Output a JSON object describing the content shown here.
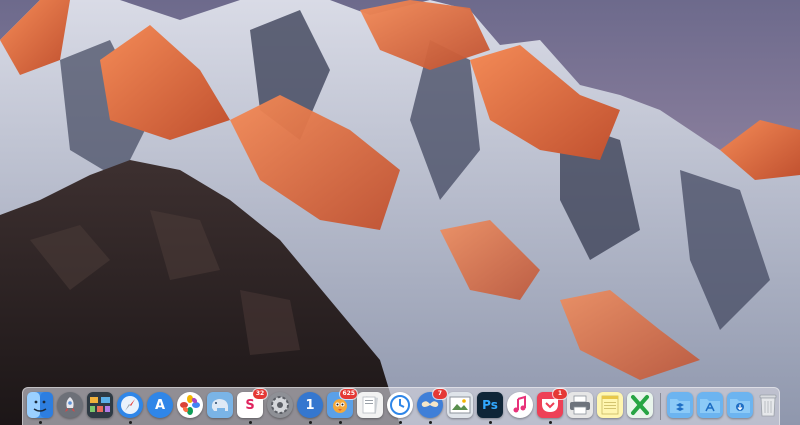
{
  "desktop": {
    "wallpaper": "macos-sierra-mountain",
    "sky_color": "#8a7f9c"
  },
  "dock": {
    "apps": [
      {
        "name": "finder",
        "icon": "finder-icon",
        "color": "#3f8fe6",
        "running": true
      },
      {
        "name": "launchpad",
        "icon": "rocket-icon",
        "color": "#6d7078",
        "running": false
      },
      {
        "name": "mission-control",
        "icon": "mission-control-icon",
        "color": "#2e3a44",
        "running": false
      },
      {
        "name": "safari",
        "icon": "compass-icon",
        "color": "#2f86e8",
        "running": true
      },
      {
        "name": "app-store",
        "icon": "app-store-icon",
        "color": "#2f86e8",
        "running": false,
        "glyph": "A"
      },
      {
        "name": "photos",
        "icon": "photos-flower-icon",
        "color": "#ffffff",
        "running": false
      },
      {
        "name": "sequel-pro",
        "icon": "elephant-icon",
        "color": "#7ab4e6",
        "running": false
      },
      {
        "name": "slack",
        "icon": "slack-icon",
        "color": "#ffffff",
        "running": true,
        "badge": "32",
        "glyph": "S"
      },
      {
        "name": "system-preferences",
        "icon": "gear-icon",
        "color": "#8e9096",
        "running": false
      },
      {
        "name": "1password",
        "icon": "keyhole-icon",
        "color": "#3577cf",
        "running": true,
        "glyph": "1"
      },
      {
        "name": "tweetbot",
        "icon": "bird-icon",
        "color": "#5aa0e8",
        "running": true,
        "badge": "625"
      },
      {
        "name": "preview",
        "icon": "document-stack-icon",
        "color": "#f2f2f2",
        "running": false
      },
      {
        "name": "timing",
        "icon": "clock-icon",
        "color": "#ffffff",
        "running": true
      },
      {
        "name": "mustache-app",
        "icon": "mustache-icon",
        "color": "#3f7fd8",
        "running": true,
        "badge": "7"
      },
      {
        "name": "photo-viewer",
        "icon": "photo-frame-icon",
        "color": "#dfe4ea",
        "running": false
      },
      {
        "name": "photoshop",
        "icon": "photoshop-icon",
        "color": "#0f2537",
        "running": true,
        "glyph": "Ps"
      },
      {
        "name": "itunes",
        "icon": "music-note-icon",
        "color": "#ffffff",
        "running": false
      },
      {
        "name": "pocket",
        "icon": "pocket-icon",
        "color": "#ee4056",
        "running": true,
        "badge": "1"
      },
      {
        "name": "printer",
        "icon": "printer-icon",
        "color": "#e6e6e6",
        "running": false
      },
      {
        "name": "notes",
        "icon": "notepad-icon",
        "color": "#fff6b0",
        "running": false
      },
      {
        "name": "excel-x",
        "icon": "x-icon",
        "color": "#27a544",
        "running": false
      }
    ],
    "stacks": [
      {
        "name": "dropbox-folder",
        "icon": "dropbox-folder-icon",
        "color": "#6cb4f0"
      },
      {
        "name": "applications-folder",
        "icon": "applications-folder-icon",
        "color": "#6cb4f0"
      },
      {
        "name": "downloads-folder",
        "icon": "downloads-folder-icon",
        "color": "#6cb4f0"
      },
      {
        "name": "trash",
        "icon": "trash-icon",
        "color": "#d9dce0"
      }
    ]
  }
}
